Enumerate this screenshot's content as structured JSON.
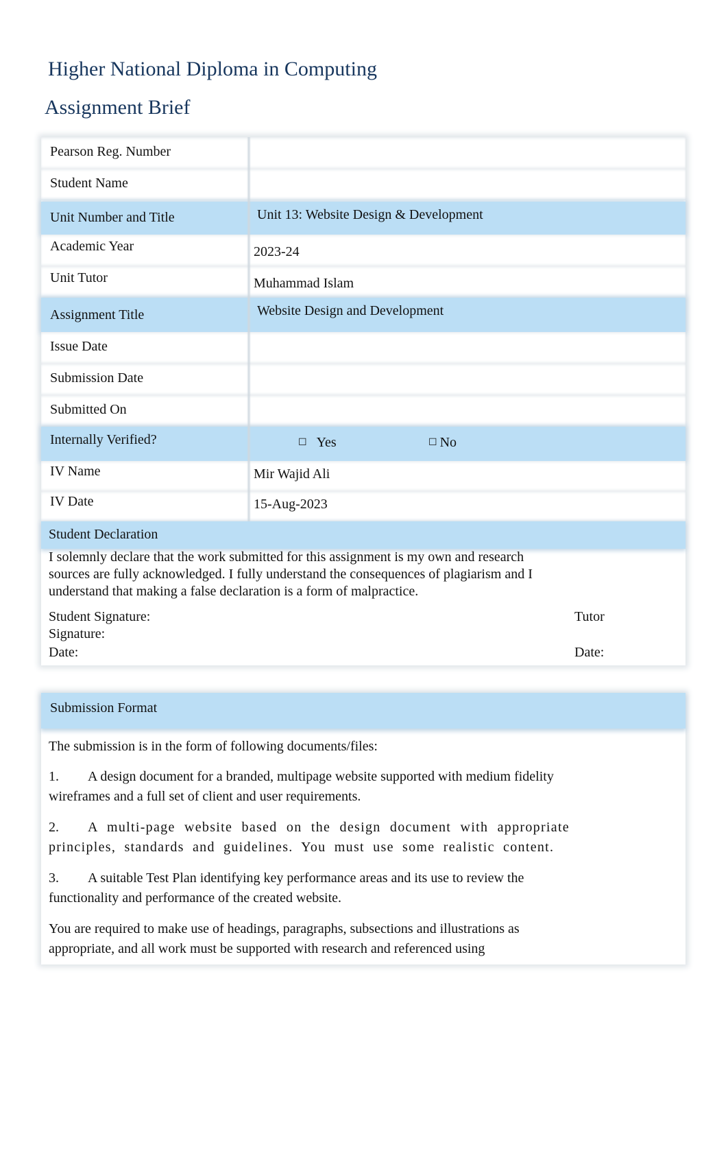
{
  "header": {
    "title": "Higher National Diploma in Computing",
    "subtitle": "Assignment Brief"
  },
  "colors": {
    "title": "#17365D",
    "row_highlight": "#BBDEF5"
  },
  "details": {
    "rows": [
      {
        "label": "Pearson Reg. Number",
        "value": ""
      },
      {
        "label": "Student Name",
        "value": ""
      },
      {
        "label": "Unit Number and Title",
        "value": "Unit 13: Website Design & Development"
      },
      {
        "label": "Academic Year",
        "value": "2023-24"
      },
      {
        "label": "Unit Tutor",
        "value": "Muhammad Islam"
      },
      {
        "label": "Assignment Title",
        "value": "Website Design and Development"
      },
      {
        "label": "Issue Date",
        "value": ""
      },
      {
        "label": "Submission Date",
        "value": ""
      },
      {
        "label": "Submitted On",
        "value": ""
      },
      {
        "label": "Internally Verified?",
        "value": ""
      },
      {
        "label": "IV Name",
        "value": "Mir Wajid Ali"
      },
      {
        "label": "IV Date",
        "value": "15-Aug-2023"
      }
    ],
    "verified_options": {
      "yes_label": "Yes",
      "no_label": "No",
      "checkbox_glyph": "☐"
    }
  },
  "declaration": {
    "heading": "Student Declaration",
    "text": "I solemnly declare that the work submitted for this assignment is my own and research sources are fully acknowledged. I fully understand the consequences of plagiarism and I understand that making a false declaration is a form of malpractice.",
    "student_signature_label": "Student Signature:",
    "tutor_label": "Tutor",
    "signature_label": "Signature:",
    "student_date_label": "Date:",
    "tutor_date_label": "Date:"
  },
  "submission_format": {
    "heading": "Submission Format",
    "intro": "The submission is in the form of following documents/files:",
    "items": [
      {
        "number": "1.",
        "text": "A design document for a branded, multipage website supported with medium fidelity wireframes and a full set of client and user requirements."
      },
      {
        "number": "2.",
        "text": "A multi-page website based on the design document with appropriate principles, standards and guidelines. You must use some realistic content."
      },
      {
        "number": "3.",
        "text": "A suitable Test Plan identifying key performance areas and its use to review the functionality and performance of the created website."
      }
    ],
    "closing": "You are required to make use of headings, paragraphs, subsections and illustrations as appropriate, and all work must be supported with research and referenced using"
  }
}
